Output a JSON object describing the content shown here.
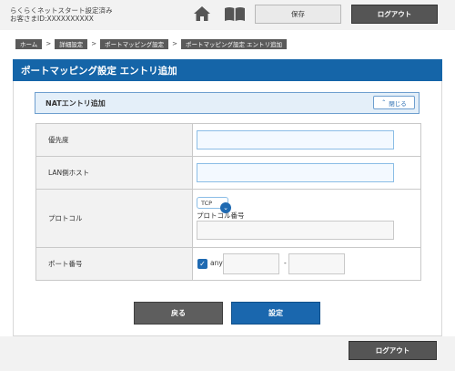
{
  "header": {
    "line1": "らくらくネットスタート設定済み",
    "line2": "お客さまID:XXXXXXXXXX",
    "save_label": "保存",
    "logout_label": "ログアウト"
  },
  "breadcrumb": [
    "ホーム",
    "詳細設定",
    "ポートマッピング設定",
    "ポートマッピング設定 エントリ追加"
  ],
  "breadcrumb_separator": ">",
  "page_title": "ポートマッピング設定 エントリ追加",
  "section": {
    "title": "NATエントリ追加",
    "close_label": "閉じる"
  },
  "form": {
    "priority": {
      "label": "優先度",
      "value": ""
    },
    "lan_host": {
      "label": "LAN側ホスト",
      "value": ""
    },
    "protocol": {
      "label": "プロトコル",
      "selected": "TCP",
      "number_label": "プロトコル番号",
      "number_value": ""
    },
    "port": {
      "label": "ポート番号",
      "any_label": "any",
      "any_checked": true,
      "from_value": "",
      "separator": "-",
      "to_value": ""
    }
  },
  "actions": {
    "back_label": "戻る",
    "submit_label": "設定"
  },
  "footer": {
    "logout_label": "ログアウト"
  },
  "colors": {
    "title_blue": "#1565a8",
    "button_blue": "#1a67ae",
    "button_gray": "#5e5e5e",
    "section_border": "#6e9fcf"
  }
}
